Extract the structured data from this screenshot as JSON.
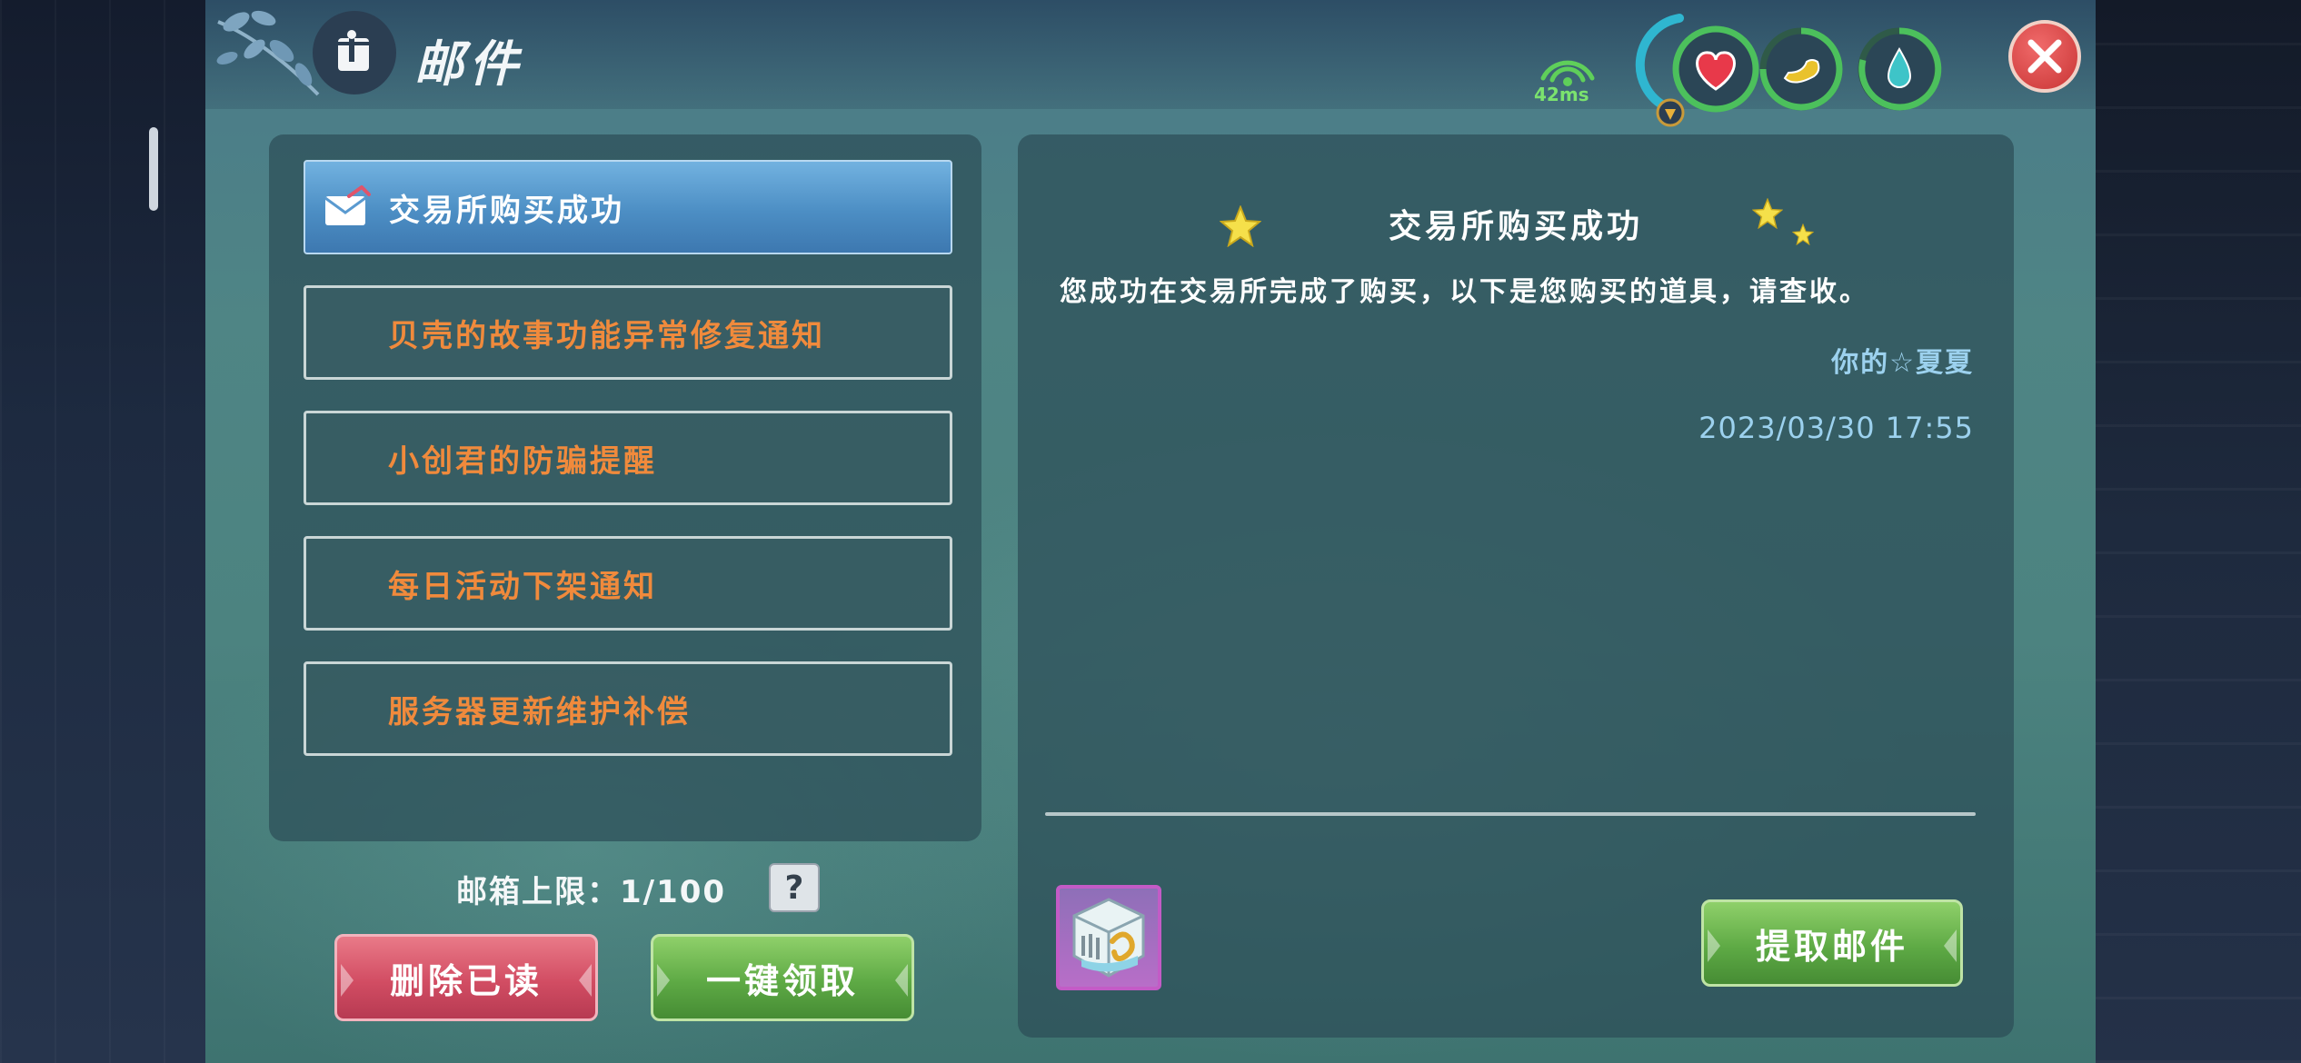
{
  "header": {
    "title": "邮件",
    "ping": "42ms"
  },
  "stats": [
    {
      "name": "health",
      "icon": "heart-icon",
      "color": "#e8394a",
      "ring": "#43b25c"
    },
    {
      "name": "hunger",
      "icon": "bread-icon",
      "color": "#e9c22c",
      "ring": "#43b25c"
    },
    {
      "name": "thirst",
      "icon": "water-drop-icon",
      "color": "#3ec4c8",
      "ring": "#43b25c"
    }
  ],
  "mail_list": [
    {
      "label": "交易所购买成功",
      "selected": true
    },
    {
      "label": "贝壳的故事功能异常修复通知",
      "selected": false
    },
    {
      "label": "小创君的防骗提醒",
      "selected": false
    },
    {
      "label": "每日活动下架通知",
      "selected": false
    },
    {
      "label": "服务器更新维护补偿",
      "selected": false
    }
  ],
  "footer": {
    "limit_label": "邮箱上限：1/100",
    "help": "?",
    "delete_read": "删除已读",
    "claim_all": "一键领取"
  },
  "detail": {
    "title": "交易所购买成功",
    "body": "您成功在交易所完成了购买，以下是您购买的道具，请查收。",
    "sender": "你的☆夏夏",
    "date": "2023/03/30 17:55",
    "take_button": "提取邮件"
  },
  "colors": {
    "unread_label": "#f08a3c",
    "selected_bg": "#5a9ad0",
    "meta_text": "#9cd1ee"
  }
}
